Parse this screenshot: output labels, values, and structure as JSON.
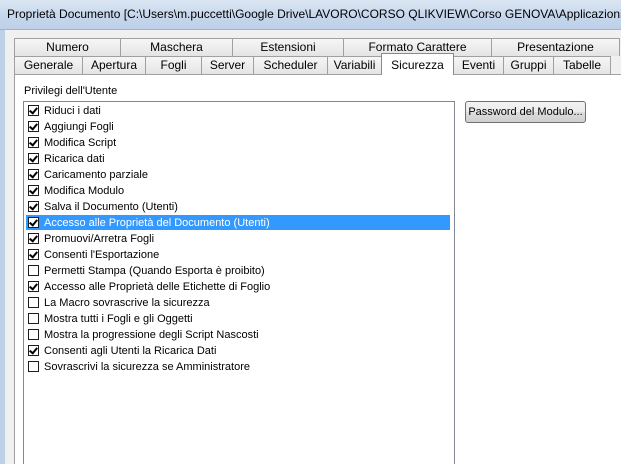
{
  "window": {
    "title": "Proprietà Documento [C:\\Users\\m.puccetti\\Google Drive\\LAVORO\\CORSO QLIKVIEW\\Corso GENOVA\\Applicazioni\\"
  },
  "tabs": {
    "back_row": [
      {
        "label": "Numero"
      },
      {
        "label": "Maschera"
      },
      {
        "label": "Estensioni"
      },
      {
        "label": "Formato Carattere"
      },
      {
        "label": "Presentazione"
      }
    ],
    "front_row": [
      {
        "label": "Generale"
      },
      {
        "label": "Apertura"
      },
      {
        "label": "Fogli"
      },
      {
        "label": "Server"
      },
      {
        "label": "Scheduler"
      },
      {
        "label": "Variabili"
      },
      {
        "label": "Sicurezza",
        "active": true
      },
      {
        "label": "Eventi"
      },
      {
        "label": "Gruppi"
      },
      {
        "label": "Tabelle"
      }
    ]
  },
  "security": {
    "group_label": "Privilegi dell'Utente",
    "password_button": "Password del Modulo...",
    "items": [
      {
        "label": "Riduci i dati",
        "checked": true
      },
      {
        "label": "Aggiungi Fogli",
        "checked": true
      },
      {
        "label": "Modifica Script",
        "checked": true
      },
      {
        "label": "Ricarica dati",
        "checked": true
      },
      {
        "label": "Caricamento parziale",
        "checked": true
      },
      {
        "label": "Modifica Modulo",
        "checked": true
      },
      {
        "label": "Salva il Documento (Utenti)",
        "checked": true
      },
      {
        "label": "Accesso alle Proprietà del Documento (Utenti)",
        "checked": true,
        "selected": true
      },
      {
        "label": "Promuovi/Arretra Fogli",
        "checked": true
      },
      {
        "label": "Consenti l'Esportazione",
        "checked": true
      },
      {
        "label": "Permetti Stampa (Quando Esporta è proibito)",
        "checked": false
      },
      {
        "label": "Accesso alle Proprietà delle Etichette di Foglio",
        "checked": true
      },
      {
        "label": "La Macro sovrascrive la sicurezza",
        "checked": false
      },
      {
        "label": "Mostra tutti i Fogli e gli Oggetti",
        "checked": false
      },
      {
        "label": "Mostra la progressione degli Script Nascosti",
        "checked": false
      },
      {
        "label": "Consenti agli Utenti la Ricarica Dati",
        "checked": true
      },
      {
        "label": "Sovrascrivi la sicurezza se Amministratore",
        "checked": false
      }
    ]
  },
  "colors": {
    "selection": "#3399ff",
    "title_bar": "#c6d7ec"
  }
}
